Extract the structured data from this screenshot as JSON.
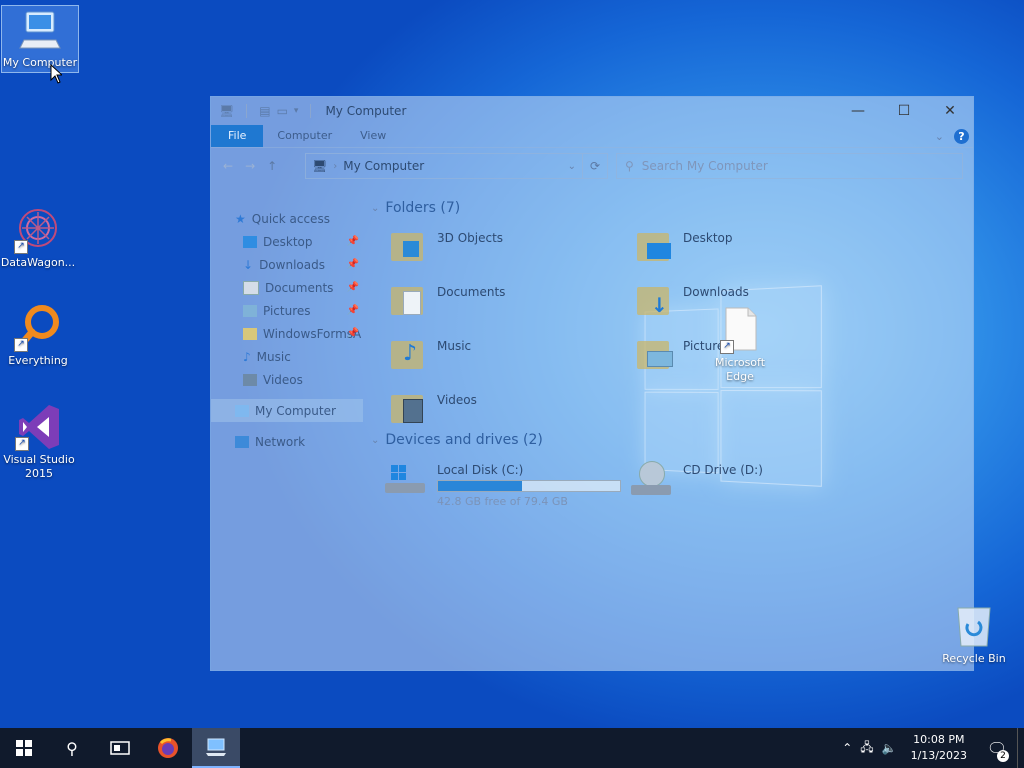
{
  "desktop": {
    "icons": [
      {
        "label": "My Computer"
      },
      {
        "label": "DataWagon..."
      },
      {
        "label": "Everything"
      },
      {
        "label": "Visual Studio 2015"
      },
      {
        "label": "Microsoft Edge"
      },
      {
        "label": "Recycle Bin"
      }
    ]
  },
  "explorer": {
    "title": "My Computer",
    "controls": {
      "minimize": "—",
      "maximize": "☐",
      "close": "✕"
    },
    "ribbon_tabs": [
      {
        "label": "File"
      },
      {
        "label": "Computer"
      },
      {
        "label": "View"
      }
    ],
    "address": "My Computer",
    "search_placeholder": "Search My Computer",
    "nav": {
      "quick_access": "Quick access",
      "items": [
        {
          "label": "Desktop"
        },
        {
          "label": "Downloads"
        },
        {
          "label": "Documents"
        },
        {
          "label": "Pictures"
        },
        {
          "label": "WindowsFormsA"
        },
        {
          "label": "Music"
        },
        {
          "label": "Videos"
        }
      ],
      "my_computer": "My Computer",
      "network": "Network"
    },
    "folders_header": "Folders (7)",
    "folders": [
      {
        "name": "3D Objects"
      },
      {
        "name": "Desktop"
      },
      {
        "name": "Documents"
      },
      {
        "name": "Downloads"
      },
      {
        "name": "Music"
      },
      {
        "name": "Pictures"
      },
      {
        "name": "Videos"
      }
    ],
    "drives_header": "Devices and drives (2)",
    "drives": [
      {
        "name": "Local Disk (C:)",
        "free": "42.8 GB free of 79.4 GB",
        "used_fraction": 0.46
      },
      {
        "name": "CD Drive (D:)"
      }
    ]
  },
  "taskbar": {
    "time": "10:08 PM",
    "date": "1/13/2023",
    "notifications": "2"
  }
}
